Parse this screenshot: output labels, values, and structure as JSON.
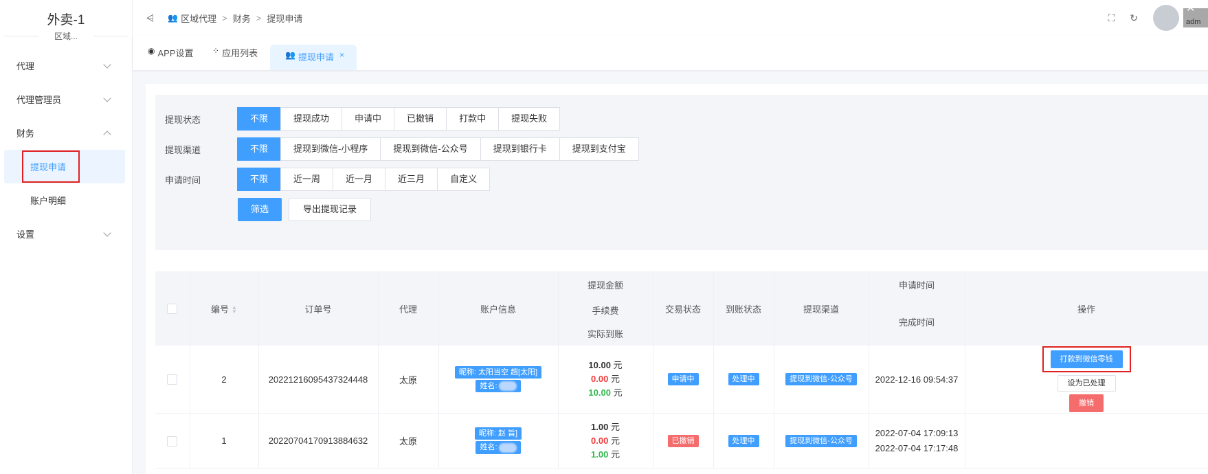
{
  "sidebar": {
    "brand_title": "外卖-1",
    "brand_sub": "区域...",
    "menu": [
      {
        "label": "代理"
      },
      {
        "label": "代理管理员"
      },
      {
        "label": "财务"
      },
      {
        "label": "设置"
      }
    ],
    "finance_children": [
      {
        "label": "提现申请"
      },
      {
        "label": "账户明细"
      }
    ],
    "active_color": "#409eff"
  },
  "topbar": {
    "breadcrumb": [
      "区域代理",
      "财务",
      "提现申请"
    ],
    "breadcrumb_sep": ">",
    "user": "adm"
  },
  "tabs": [
    {
      "label": "APP设置"
    },
    {
      "label": "应用列表"
    },
    {
      "label": "提现申请"
    }
  ],
  "filters": {
    "status": {
      "label": "提现状态",
      "options": [
        "不限",
        "提现成功",
        "申请中",
        "已撤销",
        "打款中",
        "提现失败"
      ]
    },
    "channel": {
      "label": "提现渠道",
      "options": [
        "不限",
        "提现到微信-小程序",
        "提现到微信-公众号",
        "提现到银行卡",
        "提现到支付宝"
      ]
    },
    "time": {
      "label": "申请时间",
      "options": [
        "不限",
        "近一周",
        "近一月",
        "近三月",
        "自定义"
      ]
    },
    "filter_button": "筛选",
    "export_button": "导出提现记录"
  },
  "table": {
    "headers": {
      "id": "编号",
      "order": "订单号",
      "agent": "代理",
      "account": "账户信息",
      "amount": "提现金额",
      "fee": "手续费",
      "actual": "实际到账",
      "trade_status": "交易状态",
      "arrival_status": "到账状态",
      "channel": "提现渠道",
      "apply_time": "申请时间",
      "finish_time": "完成时间",
      "ops": "操作"
    },
    "rows": [
      {
        "id": "2",
        "order": "20221216095437324448",
        "agent": "太原",
        "nickname": "昵称: 太阳当空 趙[太阳]",
        "name": "姓名:",
        "amount": "10.00",
        "fee": "0.00",
        "actual": "10.00",
        "unit": "元",
        "trade_status": "申请中",
        "arrival_status": "处理中",
        "channel": "提现到微信-公众号",
        "apply_time": "2022-12-16 09:54:37",
        "finish_time": "",
        "op_pay": "打款到微信零钱",
        "op_mark": "设为已处理",
        "op_revoke": "撤销"
      },
      {
        "id": "1",
        "order": "20220704170913884632",
        "agent": "太原",
        "nickname": "昵称: 赵      旨]",
        "name": "姓名:",
        "amount": "1.00",
        "fee": "0.00",
        "actual": "1.00",
        "unit": "元",
        "trade_status": "已撤销",
        "arrival_status": "处理中",
        "channel": "提现到微信-公众号",
        "apply_time": "2022-07-04 17:09:13",
        "finish_time": "2022-07-04 17:17:48"
      }
    ]
  }
}
